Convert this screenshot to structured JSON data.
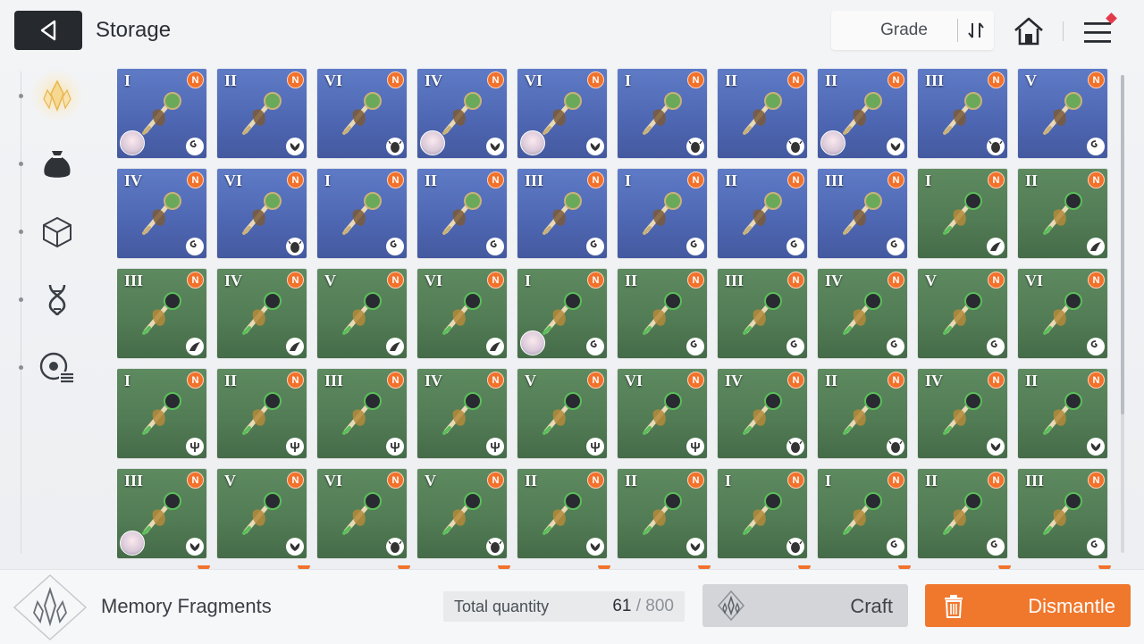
{
  "header": {
    "title": "Storage",
    "grade_label": "Grade",
    "icons": {
      "back": "back-arrow-icon",
      "sort": "sort-order-icon",
      "home": "home-icon",
      "menu": "hamburger-menu-icon"
    },
    "menu_alert_color": "#e23a4a"
  },
  "sidebar": {
    "items": [
      {
        "icon": "memory-fragment-icon",
        "active": true
      },
      {
        "icon": "pouch-icon",
        "active": false
      },
      {
        "icon": "cube-icon",
        "active": false
      },
      {
        "icon": "dna-helix-icon",
        "active": false
      },
      {
        "icon": "recall-list-icon",
        "active": false
      }
    ]
  },
  "grid": {
    "badge_text": "N",
    "rows": [
      [
        {
          "grade": "I",
          "bg": "blue",
          "item": "syringe-key",
          "type": "swirl",
          "portrait": true
        },
        {
          "grade": "II",
          "bg": "blue",
          "item": "wooden-key",
          "type": "lotus",
          "portrait": false
        },
        {
          "grade": "VI",
          "bg": "blue",
          "item": "feather-quill",
          "type": "beetle",
          "portrait": false
        },
        {
          "grade": "IV",
          "bg": "blue",
          "item": "voodoo-doll",
          "type": "lotus",
          "portrait": true
        },
        {
          "grade": "VI",
          "bg": "blue",
          "item": "vine-mask",
          "type": "lotus",
          "portrait": true
        },
        {
          "grade": "I",
          "bg": "blue",
          "item": "scarab-dagger",
          "type": "beetle",
          "portrait": false
        },
        {
          "grade": "II",
          "bg": "blue",
          "item": "scarab-staff",
          "type": "beetle",
          "portrait": false
        },
        {
          "grade": "II",
          "bg": "blue",
          "item": "wooden-key",
          "type": "lotus",
          "portrait": true
        },
        {
          "grade": "III",
          "bg": "blue",
          "item": "scarab-orb",
          "type": "beetle",
          "portrait": false
        },
        {
          "grade": "V",
          "bg": "blue",
          "item": "bone-chalice",
          "type": "swirl",
          "portrait": false
        }
      ],
      [
        {
          "grade": "IV",
          "bg": "blue",
          "item": "bone-necklace",
          "type": "swirl",
          "portrait": false
        },
        {
          "grade": "VI",
          "bg": "blue",
          "item": "feather-quill",
          "type": "beetle",
          "portrait": false
        },
        {
          "grade": "I",
          "bg": "blue",
          "item": "bone-blade",
          "type": "swirl",
          "portrait": false
        },
        {
          "grade": "II",
          "bg": "blue",
          "item": "bone-key",
          "type": "swirl",
          "portrait": false
        },
        {
          "grade": "III",
          "bg": "blue",
          "item": "bone-shell",
          "type": "swirl",
          "portrait": false
        },
        {
          "grade": "I",
          "bg": "blue",
          "item": "syringe-key",
          "type": "swirl",
          "portrait": false
        },
        {
          "grade": "II",
          "bg": "blue",
          "item": "vial-key",
          "type": "swirl",
          "portrait": false
        },
        {
          "grade": "III",
          "bg": "blue",
          "item": "potion-flask",
          "type": "swirl",
          "portrait": false
        },
        {
          "grade": "I",
          "bg": "green",
          "item": "crow-blade",
          "type": "wing",
          "portrait": false
        },
        {
          "grade": "II",
          "bg": "green",
          "item": "crow-key",
          "type": "wing",
          "portrait": false
        }
      ],
      [
        {
          "grade": "III",
          "bg": "green",
          "item": "crow-orb",
          "type": "wing",
          "portrait": false
        },
        {
          "grade": "IV",
          "bg": "green",
          "item": "crow-pendant",
          "type": "wing",
          "portrait": false
        },
        {
          "grade": "V",
          "bg": "green",
          "item": "crow-chalice",
          "type": "wing",
          "portrait": false
        },
        {
          "grade": "VI",
          "bg": "green",
          "item": "crow-feather",
          "type": "wing",
          "portrait": false
        },
        {
          "grade": "I",
          "bg": "green",
          "item": "syringe-key",
          "type": "swirl",
          "portrait": true
        },
        {
          "grade": "II",
          "bg": "green",
          "item": "vial-key",
          "type": "swirl",
          "portrait": false
        },
        {
          "grade": "III",
          "bg": "green",
          "item": "potion-flask",
          "type": "swirl",
          "portrait": false
        },
        {
          "grade": "IV",
          "bg": "green",
          "item": "vial-chain",
          "type": "swirl",
          "portrait": false
        },
        {
          "grade": "V",
          "bg": "green",
          "item": "potion-glass",
          "type": "swirl",
          "portrait": false
        },
        {
          "grade": "VI",
          "bg": "green",
          "item": "vial-claw",
          "type": "swirl",
          "portrait": false
        }
      ],
      [
        {
          "grade": "I",
          "bg": "green",
          "item": "trident-shield",
          "type": "trident",
          "portrait": false
        },
        {
          "grade": "II",
          "bg": "green",
          "item": "trident-key",
          "type": "trident",
          "portrait": false
        },
        {
          "grade": "III",
          "bg": "green",
          "item": "trident-orb",
          "type": "trident",
          "portrait": false
        },
        {
          "grade": "IV",
          "bg": "green",
          "item": "trident-pendant",
          "type": "trident",
          "portrait": false
        },
        {
          "grade": "V",
          "bg": "green",
          "item": "trident-lantern",
          "type": "trident",
          "portrait": false
        },
        {
          "grade": "VI",
          "bg": "green",
          "item": "trident-staff",
          "type": "trident",
          "portrait": false
        },
        {
          "grade": "IV",
          "bg": "green",
          "item": "scarab-amulet",
          "type": "beetle",
          "portrait": false
        },
        {
          "grade": "II",
          "bg": "green",
          "item": "scarab-staff",
          "type": "beetle",
          "portrait": false
        },
        {
          "grade": "IV",
          "bg": "green",
          "item": "voodoo-doll",
          "type": "lotus",
          "portrait": false
        },
        {
          "grade": "II",
          "bg": "green",
          "item": "wooden-key",
          "type": "lotus",
          "portrait": false
        }
      ],
      [
        {
          "grade": "III",
          "bg": "green",
          "item": "skull-nest",
          "type": "lotus",
          "portrait": true
        },
        {
          "grade": "V",
          "bg": "green",
          "item": "skull-bowl",
          "type": "lotus",
          "portrait": false
        },
        {
          "grade": "VI",
          "bg": "green",
          "item": "feather-quill",
          "type": "beetle",
          "portrait": false
        },
        {
          "grade": "V",
          "bg": "green",
          "item": "golden-chalice",
          "type": "beetle",
          "portrait": false
        },
        {
          "grade": "II",
          "bg": "green",
          "item": "wooden-key",
          "type": "lotus",
          "portrait": false
        },
        {
          "grade": "II",
          "bg": "green",
          "item": "wooden-key",
          "type": "lotus",
          "portrait": false
        },
        {
          "grade": "I",
          "bg": "green",
          "item": "scarab-dagger",
          "type": "beetle",
          "portrait": false
        },
        {
          "grade": "I",
          "bg": "green",
          "item": "bone-blade",
          "type": "swirl",
          "portrait": false
        },
        {
          "grade": "II",
          "bg": "green",
          "item": "bone-key",
          "type": "swirl",
          "portrait": false
        },
        {
          "grade": "III",
          "bg": "green",
          "item": "bone-shell",
          "type": "swirl",
          "portrait": false
        }
      ]
    ]
  },
  "bottom": {
    "fragment_label": "Memory Fragments",
    "total_label": "Total quantity",
    "total_current": "61",
    "total_separator": " / ",
    "total_max": "800",
    "craft_label": "Craft",
    "dismantle_label": "Dismantle",
    "dismantle_color": "#f0782d"
  }
}
